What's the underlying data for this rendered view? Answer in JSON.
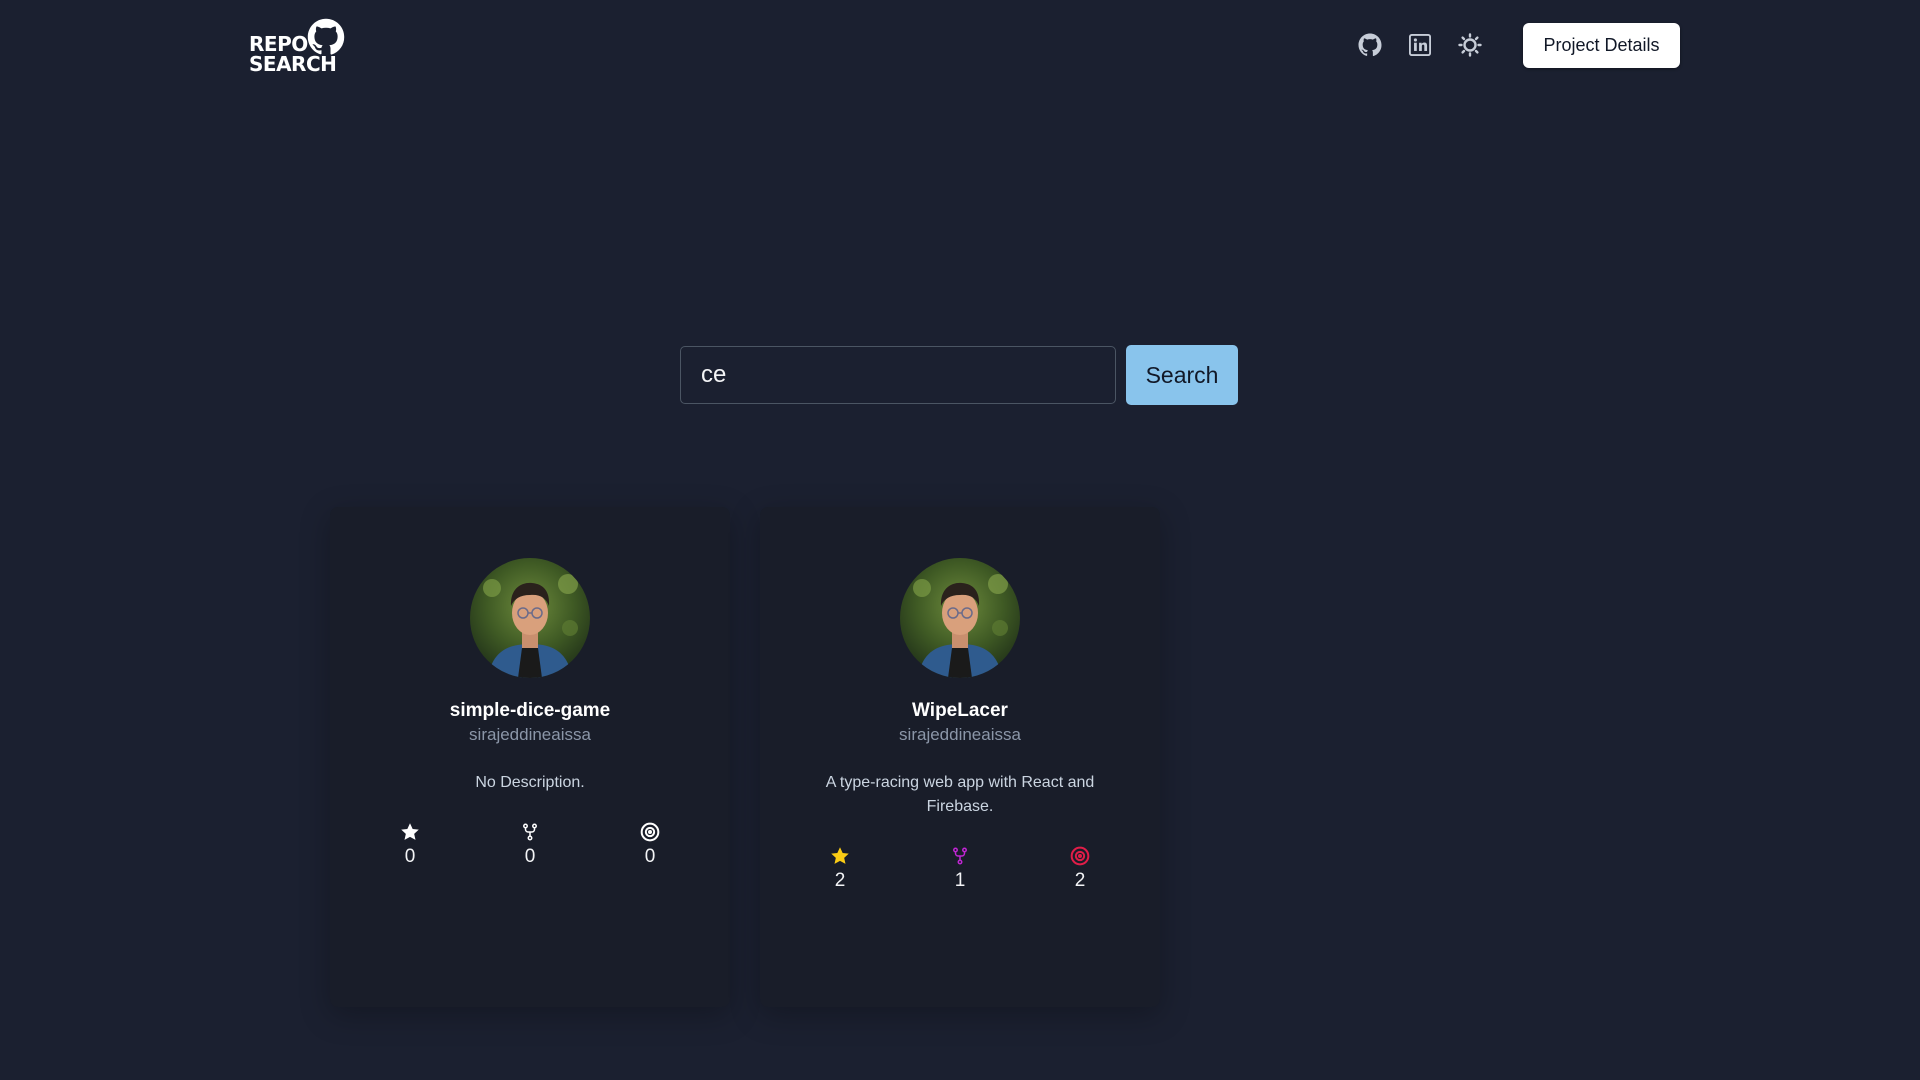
{
  "header": {
    "logo_line1": "REPO",
    "logo_line2": "SEARCH",
    "project_button": "Project Details",
    "icons": [
      "github-icon",
      "linkedin-icon",
      "theme-toggle-icon"
    ]
  },
  "search": {
    "query": "ce",
    "button_label": "Search"
  },
  "colors": {
    "background": "#1b2030",
    "card": "#191d29",
    "search_button": "#89c4ec",
    "star_active": "#facc15",
    "fork_active": "#c026d3",
    "issue_active": "#e11d48",
    "inactive_icon": "#ffffff"
  },
  "cards": [
    {
      "name": "simple-dice-game",
      "owner": "sirajeddineaissa",
      "description": "No Description.",
      "stars": "0",
      "forks": "0",
      "issues": "0",
      "active": false
    },
    {
      "name": "WipeLacer",
      "owner": "sirajeddineaissa",
      "description": "A type-racing web app with React and Firebase.",
      "stars": "2",
      "forks": "1",
      "issues": "2",
      "active": true
    }
  ]
}
